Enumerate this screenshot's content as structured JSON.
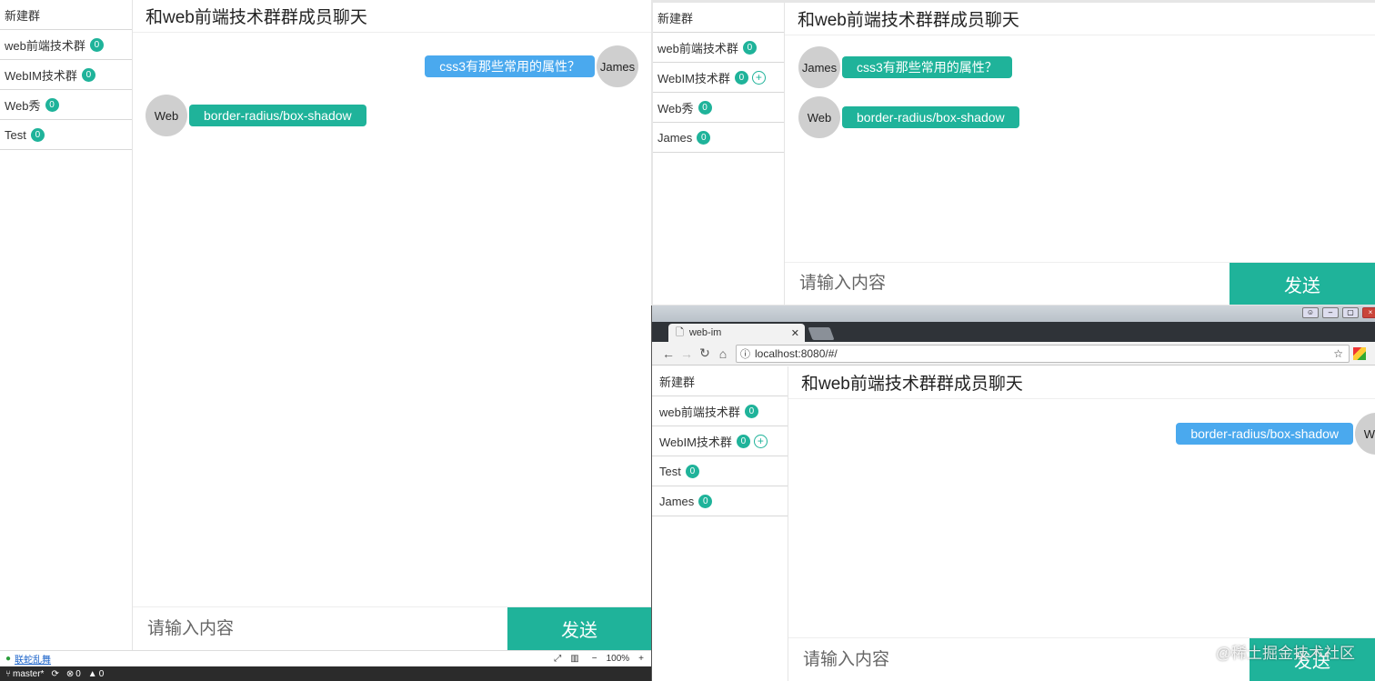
{
  "chat_title": "和web前端技术群群成员聊天",
  "composer": {
    "placeholder": "请输入内容",
    "send_label": "发送"
  },
  "win1": {
    "groups": [
      {
        "name": "新建群"
      },
      {
        "name": "web前端技术群",
        "count": "0"
      },
      {
        "name": "WebIM技术群",
        "count": "0"
      },
      {
        "name": "Web秀",
        "count": "0"
      },
      {
        "name": "Test",
        "count": "0"
      }
    ],
    "messages": [
      {
        "author": "James",
        "text": "css3有那些常用的属性？"
      },
      {
        "author": "Web",
        "text": "border-radius/box-shadow"
      }
    ]
  },
  "win2": {
    "groups": [
      {
        "name": "新建群"
      },
      {
        "name": "web前端技术群",
        "count": "0"
      },
      {
        "name": "WebIM技术群",
        "count": "0"
      },
      {
        "name": "Web秀",
        "count": "0"
      },
      {
        "name": "James",
        "count": "0"
      }
    ],
    "messages": [
      {
        "author": "James",
        "text": "css3有那些常用的属性？"
      },
      {
        "author": "Web",
        "text": "border-radius/box-shadow"
      }
    ]
  },
  "win3": {
    "browser": {
      "tab_title": "web-im",
      "url": "localhost:8080/#/"
    },
    "groups": [
      {
        "name": "新建群"
      },
      {
        "name": "web前端技术群",
        "count": "0"
      },
      {
        "name": "WebIM技术群",
        "count": "0"
      },
      {
        "name": "Test",
        "count": "0"
      },
      {
        "name": "James",
        "count": "0"
      }
    ],
    "messages": [
      {
        "author": "Web",
        "text": "border-radius/box-shadow"
      }
    ]
  },
  "editor_status": {
    "plugin_label": "联蛇乱舞",
    "zoom": "100%",
    "branch": "master*",
    "errors": "0",
    "warnings": "0"
  },
  "watermark": "@稀土掘金技术社区",
  "colors": {
    "accent": "#1fb39a",
    "bubble_blue": "#4aa9ee"
  }
}
